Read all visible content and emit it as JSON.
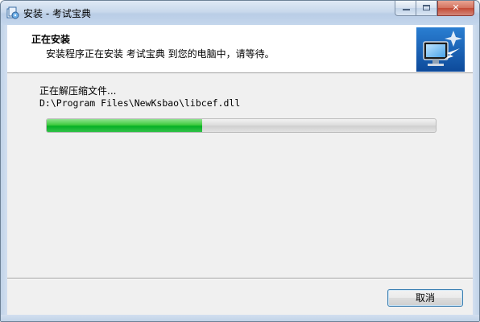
{
  "window": {
    "title": "安装 - 考试宝典",
    "app_icon": "installer-icon",
    "buttons": {
      "minimize": "minimize-icon",
      "maximize": "maximize-icon",
      "close": "close-icon"
    }
  },
  "header": {
    "title": "正在安装",
    "subtitle": "安装程序正在安装 考试宝典 到您的电脑中，请等待。",
    "image": "computer-install-icon"
  },
  "body": {
    "status": "正在解压缩文件...",
    "current_file": "D:\\Program Files\\NewKsbao\\libcef.dll",
    "progress_fraction": 0.4
  },
  "footer": {
    "cancel_label": "取消"
  },
  "colors": {
    "progress_green": "#06b025",
    "title_bar": "#c9d9ec",
    "close_red": "#c34a35"
  }
}
